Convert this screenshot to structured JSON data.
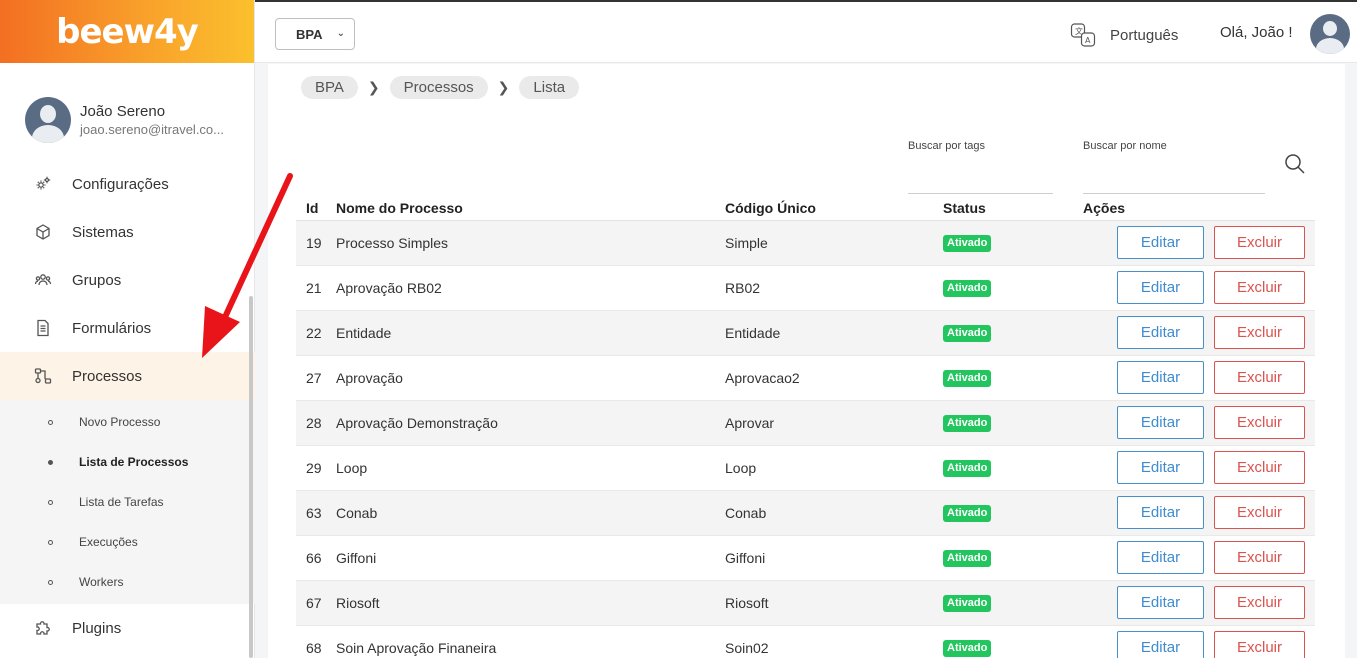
{
  "brand": {
    "logo": "beew4y",
    "gradient_start": "#f36f22",
    "gradient_end": "#fbc02d"
  },
  "user": {
    "name": "João Sereno",
    "email": "joao.sereno@itravel.co..."
  },
  "nav": {
    "items": [
      {
        "label": "Configurações",
        "icon": "gear-icon"
      },
      {
        "label": "Sistemas",
        "icon": "cube-icon"
      },
      {
        "label": "Grupos",
        "icon": "users-icon"
      },
      {
        "label": "Formulários",
        "icon": "document-icon"
      },
      {
        "label": "Processos",
        "icon": "process-icon",
        "active": true
      }
    ],
    "sub_items": [
      {
        "label": "Novo Processo"
      },
      {
        "label": "Lista de Processos",
        "active": true
      },
      {
        "label": "Lista de Tarefas"
      },
      {
        "label": "Execuções"
      },
      {
        "label": "Workers"
      }
    ],
    "plugins": {
      "label": "Plugins",
      "icon": "puzzle-icon"
    }
  },
  "topbar": {
    "workspace": "BPA",
    "language": "Português",
    "greeting": "Olá, João !"
  },
  "breadcrumb": [
    "BPA",
    "Processos",
    "Lista"
  ],
  "search": {
    "tags_label": "Buscar por tags",
    "name_label": "Buscar por nome",
    "tags_value": "",
    "name_value": ""
  },
  "table": {
    "headers": {
      "id": "Id",
      "name": "Nome do Processo",
      "code": "Código Único",
      "status": "Status",
      "actions": "Ações"
    },
    "edit_label": "Editar",
    "delete_label": "Excluir",
    "rows": [
      {
        "id": "19",
        "name": "Processo Simples",
        "code": "Simple",
        "status": "Ativado"
      },
      {
        "id": "21",
        "name": "Aprovação RB02",
        "code": "RB02",
        "status": "Ativado"
      },
      {
        "id": "22",
        "name": "Entidade",
        "code": "Entidade",
        "status": "Ativado"
      },
      {
        "id": "27",
        "name": "Aprovação",
        "code": "Aprovacao2",
        "status": "Ativado"
      },
      {
        "id": "28",
        "name": "Aprovação Demonstração",
        "code": "Aprovar",
        "status": "Ativado"
      },
      {
        "id": "29",
        "name": "Loop",
        "code": "Loop",
        "status": "Ativado"
      },
      {
        "id": "63",
        "name": "Conab",
        "code": "Conab",
        "status": "Ativado"
      },
      {
        "id": "66",
        "name": "Giffoni",
        "code": "Giffoni",
        "status": "Ativado"
      },
      {
        "id": "67",
        "name": "Riosoft",
        "code": "Riosoft",
        "status": "Ativado"
      },
      {
        "id": "68",
        "name": "Soin Aprovação Finaneira",
        "code": "Soin02",
        "status": "Ativado"
      }
    ]
  },
  "colors": {
    "status_active": "#22c55e",
    "edit": "#3d8bd0",
    "delete": "#d9534f",
    "annotation_arrow": "#e8141a"
  }
}
